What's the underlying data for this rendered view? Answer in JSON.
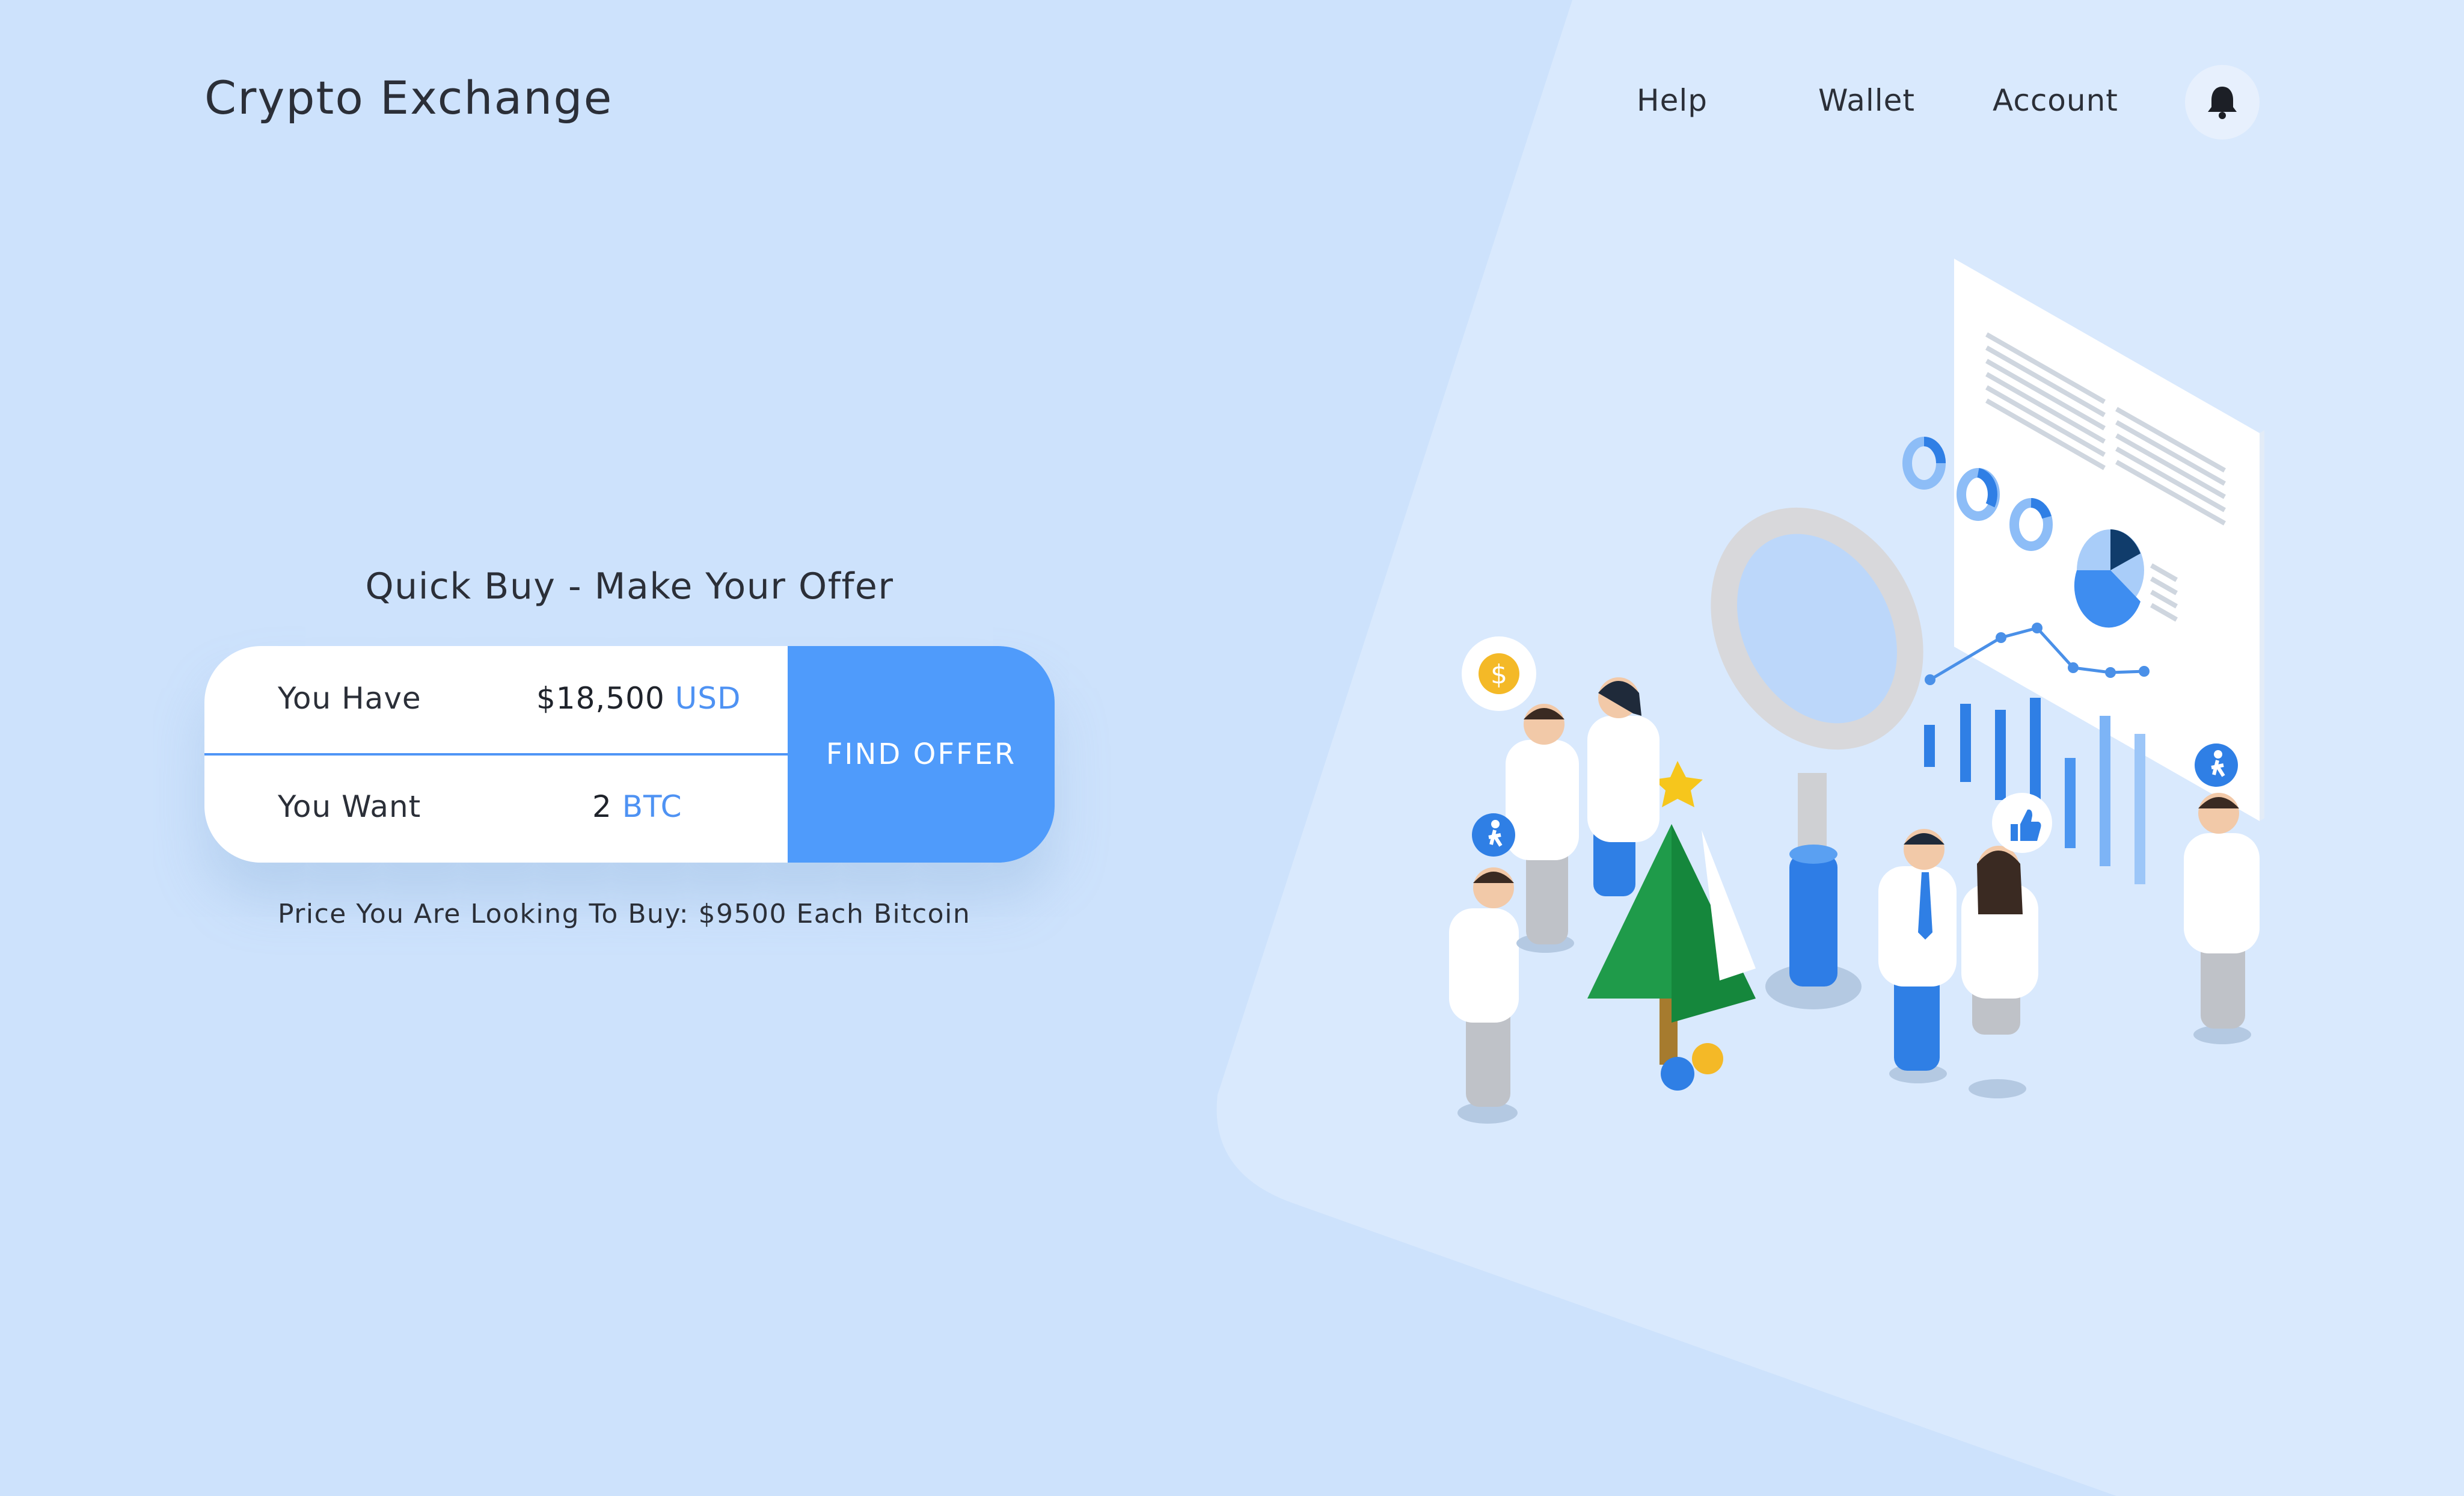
{
  "header": {
    "brand": "Crypto Exchange",
    "nav": [
      "Help",
      "Wallet",
      "Account"
    ],
    "notification_icon": "bell-icon"
  },
  "quick_buy": {
    "title": "Quick Buy - Make Your Offer",
    "have": {
      "label": "You Have",
      "amount": "$18,500",
      "currency": "USD"
    },
    "want": {
      "label": "You Want",
      "amount": "2",
      "currency": "BTC"
    },
    "button_label": "FIND OFFER",
    "price_note": "Price You Are Looking To Buy: $9500 Each Bitcoin"
  },
  "colors": {
    "background": "#cde2fc",
    "panel": "#d9e9fd",
    "accent": "#4f9bfb",
    "text": "#2b2f38"
  }
}
